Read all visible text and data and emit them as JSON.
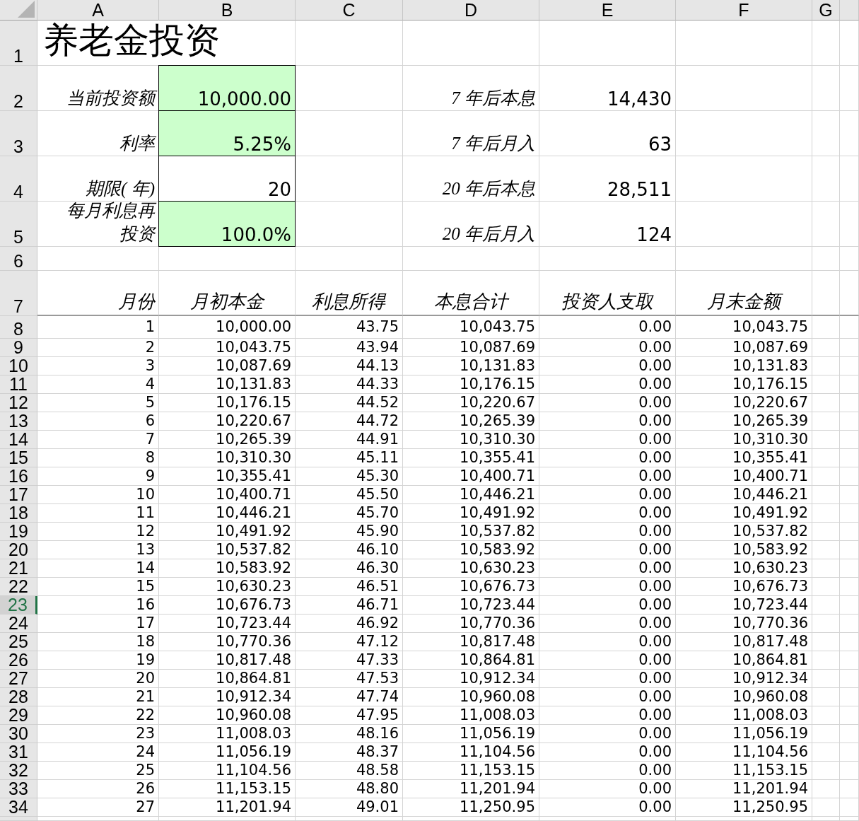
{
  "columns": [
    "A",
    "B",
    "C",
    "D",
    "E",
    "F",
    "G"
  ],
  "title_row": {
    "row": "1",
    "title": "养老金投资"
  },
  "top_rows": [
    {
      "row": "2",
      "label": "当前投资额",
      "input": "10,000.00",
      "filled": true,
      "result_label": "7 年后本息",
      "result": "14,430"
    },
    {
      "row": "3",
      "label": "利率",
      "input": "5.25%",
      "filled": true,
      "result_label": "7 年后月入",
      "result": "63"
    },
    {
      "row": "4",
      "label": "期限( 年)",
      "input": "20",
      "filled": false,
      "result_label": "20 年后本息",
      "result": "28,511"
    },
    {
      "row": "5",
      "label": "每月利息再投资",
      "input": "100.0%",
      "filled": true,
      "result_label": "20 年后月入",
      "result": "124"
    }
  ],
  "blank_row": "6",
  "header_row": {
    "row": "7",
    "labels": [
      "月份",
      "月初本金",
      "利息所得",
      "本息合计",
      "投资人支取",
      "月末金额"
    ]
  },
  "rows": [
    {
      "row": "8",
      "selected": false,
      "cells": [
        "1",
        "10,000.00",
        "43.75",
        "10,043.75",
        "0.00",
        "10,043.75"
      ]
    },
    {
      "row": "9",
      "selected": false,
      "cells": [
        "2",
        "10,043.75",
        "43.94",
        "10,087.69",
        "0.00",
        "10,087.69"
      ]
    },
    {
      "row": "10",
      "selected": false,
      "cells": [
        "3",
        "10,087.69",
        "44.13",
        "10,131.83",
        "0.00",
        "10,131.83"
      ]
    },
    {
      "row": "11",
      "selected": false,
      "cells": [
        "4",
        "10,131.83",
        "44.33",
        "10,176.15",
        "0.00",
        "10,176.15"
      ]
    },
    {
      "row": "12",
      "selected": false,
      "cells": [
        "5",
        "10,176.15",
        "44.52",
        "10,220.67",
        "0.00",
        "10,220.67"
      ]
    },
    {
      "row": "13",
      "selected": false,
      "cells": [
        "6",
        "10,220.67",
        "44.72",
        "10,265.39",
        "0.00",
        "10,265.39"
      ]
    },
    {
      "row": "14",
      "selected": false,
      "cells": [
        "7",
        "10,265.39",
        "44.91",
        "10,310.30",
        "0.00",
        "10,310.30"
      ]
    },
    {
      "row": "15",
      "selected": false,
      "cells": [
        "8",
        "10,310.30",
        "45.11",
        "10,355.41",
        "0.00",
        "10,355.41"
      ]
    },
    {
      "row": "16",
      "selected": false,
      "cells": [
        "9",
        "10,355.41",
        "45.30",
        "10,400.71",
        "0.00",
        "10,400.71"
      ]
    },
    {
      "row": "17",
      "selected": false,
      "cells": [
        "10",
        "10,400.71",
        "45.50",
        "10,446.21",
        "0.00",
        "10,446.21"
      ]
    },
    {
      "row": "18",
      "selected": false,
      "cells": [
        "11",
        "10,446.21",
        "45.70",
        "10,491.92",
        "0.00",
        "10,491.92"
      ]
    },
    {
      "row": "19",
      "selected": false,
      "cells": [
        "12",
        "10,491.92",
        "45.90",
        "10,537.82",
        "0.00",
        "10,537.82"
      ]
    },
    {
      "row": "20",
      "selected": false,
      "cells": [
        "13",
        "10,537.82",
        "46.10",
        "10,583.92",
        "0.00",
        "10,583.92"
      ]
    },
    {
      "row": "21",
      "selected": false,
      "cells": [
        "14",
        "10,583.92",
        "46.30",
        "10,630.23",
        "0.00",
        "10,630.23"
      ]
    },
    {
      "row": "22",
      "selected": false,
      "cells": [
        "15",
        "10,630.23",
        "46.51",
        "10,676.73",
        "0.00",
        "10,676.73"
      ]
    },
    {
      "row": "23",
      "selected": true,
      "cells": [
        "16",
        "10,676.73",
        "46.71",
        "10,723.44",
        "0.00",
        "10,723.44"
      ]
    },
    {
      "row": "24",
      "selected": false,
      "cells": [
        "17",
        "10,723.44",
        "46.92",
        "10,770.36",
        "0.00",
        "10,770.36"
      ]
    },
    {
      "row": "25",
      "selected": false,
      "cells": [
        "18",
        "10,770.36",
        "47.12",
        "10,817.48",
        "0.00",
        "10,817.48"
      ]
    },
    {
      "row": "26",
      "selected": false,
      "cells": [
        "19",
        "10,817.48",
        "47.33",
        "10,864.81",
        "0.00",
        "10,864.81"
      ]
    },
    {
      "row": "27",
      "selected": false,
      "cells": [
        "20",
        "10,864.81",
        "47.53",
        "10,912.34",
        "0.00",
        "10,912.34"
      ]
    },
    {
      "row": "28",
      "selected": false,
      "cells": [
        "21",
        "10,912.34",
        "47.74",
        "10,960.08",
        "0.00",
        "10,960.08"
      ]
    },
    {
      "row": "29",
      "selected": false,
      "cells": [
        "22",
        "10,960.08",
        "47.95",
        "11,008.03",
        "0.00",
        "11,008.03"
      ]
    },
    {
      "row": "30",
      "selected": false,
      "cells": [
        "23",
        "11,008.03",
        "48.16",
        "11,056.19",
        "0.00",
        "11,056.19"
      ]
    },
    {
      "row": "31",
      "selected": false,
      "cells": [
        "24",
        "11,056.19",
        "48.37",
        "11,104.56",
        "0.00",
        "11,104.56"
      ]
    },
    {
      "row": "32",
      "selected": false,
      "cells": [
        "25",
        "11,104.56",
        "48.58",
        "11,153.15",
        "0.00",
        "11,153.15"
      ]
    },
    {
      "row": "33",
      "selected": false,
      "cells": [
        "26",
        "11,153.15",
        "48.80",
        "11,201.94",
        "0.00",
        "11,201.94"
      ]
    },
    {
      "row": "34",
      "selected": false,
      "cells": [
        "27",
        "11,201.94",
        "49.01",
        "11,250.95",
        "0.00",
        "11,250.95"
      ]
    }
  ]
}
